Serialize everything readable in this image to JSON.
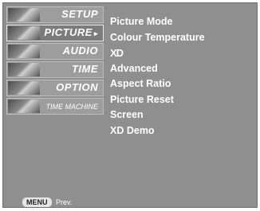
{
  "menu": {
    "items": [
      {
        "label": "SETUP",
        "icon": "setup-thumbnail-icon"
      },
      {
        "label": "PICTURE",
        "arrow": "▸",
        "icon": "picture-thumbnail-icon",
        "selected": true
      },
      {
        "label": "AUDIO",
        "icon": "audio-thumbnail-icon"
      },
      {
        "label": "TIME",
        "icon": "time-thumbnail-icon"
      },
      {
        "label": "OPTION",
        "icon": "option-thumbnail-icon"
      },
      {
        "label": "TIME MACHINE",
        "icon": "time-machine-thumbnail-icon"
      }
    ]
  },
  "footer": {
    "menu_key": "MENU",
    "prev": "Prev."
  },
  "submenu": {
    "items": [
      "Picture Mode",
      "Colour Temperature",
      "XD",
      "Advanced",
      "Aspect Ratio",
      "Picture Reset",
      "Screen",
      "XD Demo"
    ]
  }
}
